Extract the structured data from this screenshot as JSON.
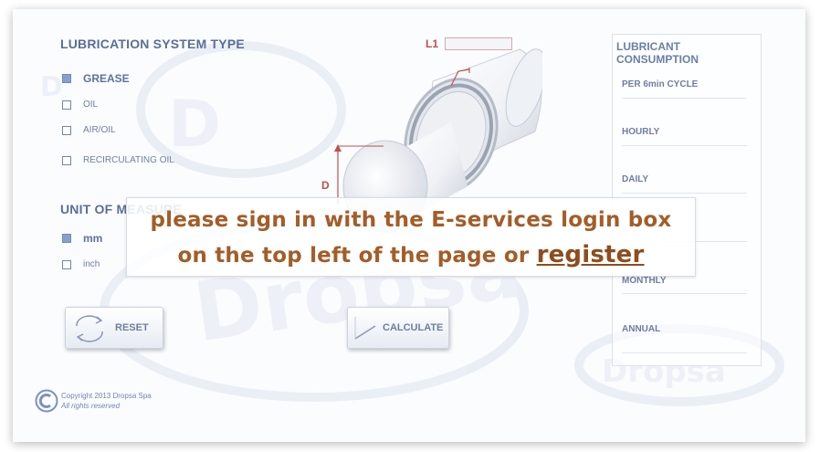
{
  "lubrication": {
    "title": "LUBRICATION SYSTEM TYPE",
    "options": [
      {
        "label": "GREASE",
        "selected": true
      },
      {
        "label": "OIL",
        "selected": false
      },
      {
        "label": "AIR/OIL",
        "selected": false
      },
      {
        "label": "RECIRCULATING OIL",
        "selected": false
      }
    ]
  },
  "unit": {
    "title": "UNIT OF MEASURE",
    "options": [
      {
        "label": "mm",
        "selected": true
      },
      {
        "label": "inch",
        "selected": false
      }
    ]
  },
  "buttons": {
    "reset": "RESET",
    "calculate": "CALCULATE"
  },
  "diagram": {
    "l1_label": "L1",
    "d_label": "D",
    "l1_value": ""
  },
  "consumption": {
    "title": "LUBRICANT CONSUMPTION",
    "rows": [
      "PER 6min CYCLE",
      "HOURLY",
      "DAILY",
      "",
      "MONTHLY",
      "ANNUAL"
    ]
  },
  "overlay": {
    "line1": "please sign in with the E-services login box",
    "line2": "on the top left of the page or",
    "register": "register"
  },
  "footer": {
    "copyright": "Copyright 2013 Dropsa Spa",
    "rights": "All rights reserved"
  },
  "colors": {
    "accent": "#5a6f96",
    "message": "#a35d28",
    "dimension": "#c0504d"
  }
}
